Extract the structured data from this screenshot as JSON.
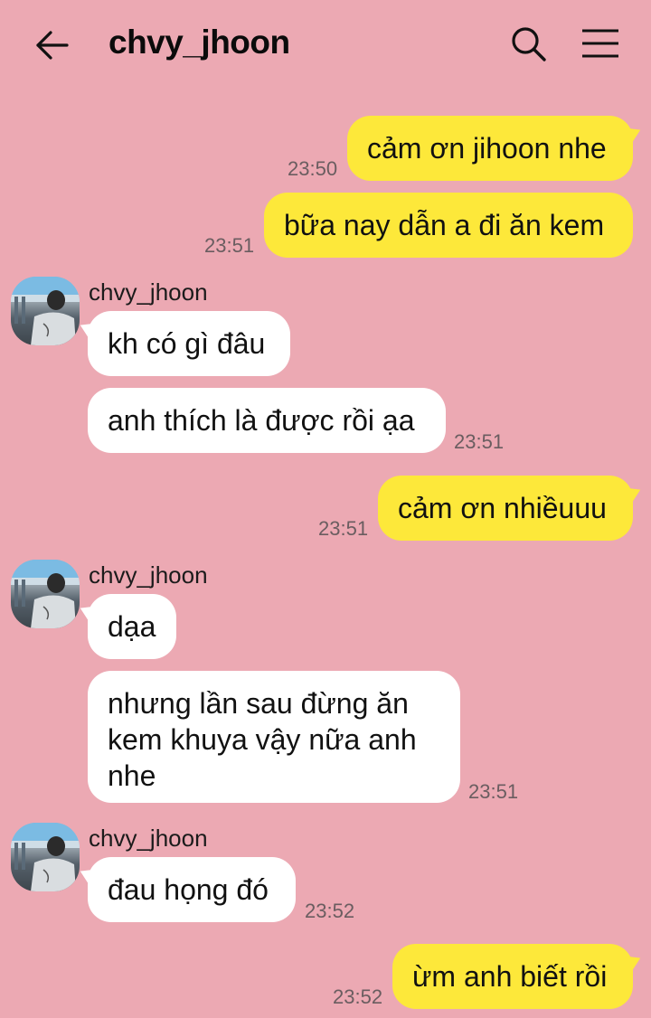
{
  "header": {
    "title": "chvy_jhoon",
    "back_icon": "arrow-left-icon",
    "search_icon": "search-icon",
    "menu_icon": "hamburger-menu-icon"
  },
  "colors": {
    "background": "#ECA9B3",
    "outgoing_bubble": "#FDE83A",
    "incoming_bubble": "#FFFFFF"
  },
  "messages": [
    {
      "side": "me",
      "text": "cảm ơn jihoon nhe",
      "time": "23:50"
    },
    {
      "side": "me",
      "text": "bữa nay dẫn a đi ăn kem",
      "time": "23:51"
    },
    {
      "side": "them",
      "sender": "chvy_jhoon",
      "text": "kh có gì đâu"
    },
    {
      "side": "them",
      "text": "anh thích là được rồi ạa",
      "time": "23:51"
    },
    {
      "side": "me",
      "text": "cảm ơn nhiềuuu",
      "time": "23:51"
    },
    {
      "side": "them",
      "sender": "chvy_jhoon",
      "text": "dạa"
    },
    {
      "side": "them",
      "text": "nhưng lần sau đừng ăn kem khuya vậy nữa anh nhe",
      "time": "23:51"
    },
    {
      "side": "them",
      "sender": "chvy_jhoon",
      "text": "đau họng đó",
      "time": "23:52"
    },
    {
      "side": "me",
      "text": "ừm anh biết rồi",
      "time": "23:52"
    }
  ]
}
